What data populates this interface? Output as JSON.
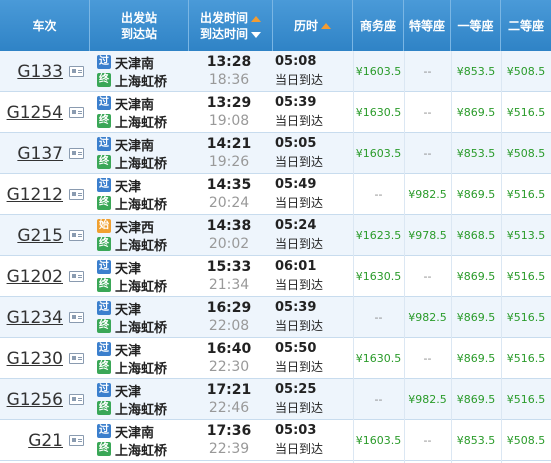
{
  "header": {
    "train": "车次",
    "station_dep": "出发站",
    "station_arr": "到达站",
    "time_dep": "出发时间",
    "time_arr": "到达时间",
    "duration": "历时",
    "business": "商务座",
    "premium": "特等座",
    "first": "一等座",
    "second": "二等座"
  },
  "colors": {
    "header_bg": "#3a8fd0",
    "sort_up": "#f39c32",
    "price": "#2a9b2a",
    "badge_pass": "#3b7fcd",
    "badge_start": "#f0a030",
    "badge_end": "#3aa757"
  },
  "rows": [
    {
      "train": "G133",
      "dep_badge": "过",
      "dep_badge_type": "guo",
      "dep": "天津南",
      "arr_badge": "终",
      "arr": "上海虹桥",
      "dep_time": "13:28",
      "arr_time": "18:36",
      "dur": "05:08",
      "arrive_note": "当日到达",
      "business": "¥1603.5",
      "premium": "--",
      "first": "¥853.5",
      "second": "¥508.5"
    },
    {
      "train": "G1254",
      "dep_badge": "过",
      "dep_badge_type": "guo",
      "dep": "天津南",
      "arr_badge": "终",
      "arr": "上海虹桥",
      "dep_time": "13:29",
      "arr_time": "19:08",
      "dur": "05:39",
      "arrive_note": "当日到达",
      "business": "¥1630.5",
      "premium": "--",
      "first": "¥869.5",
      "second": "¥516.5"
    },
    {
      "train": "G137",
      "dep_badge": "过",
      "dep_badge_type": "guo",
      "dep": "天津南",
      "arr_badge": "终",
      "arr": "上海虹桥",
      "dep_time": "14:21",
      "arr_time": "19:26",
      "dur": "05:05",
      "arrive_note": "当日到达",
      "business": "¥1603.5",
      "premium": "--",
      "first": "¥853.5",
      "second": "¥508.5"
    },
    {
      "train": "G1212",
      "dep_badge": "过",
      "dep_badge_type": "guo",
      "dep": "天津",
      "arr_badge": "终",
      "arr": "上海虹桥",
      "dep_time": "14:35",
      "arr_time": "20:24",
      "dur": "05:49",
      "arrive_note": "当日到达",
      "business": "--",
      "premium": "¥982.5",
      "first": "¥869.5",
      "second": "¥516.5"
    },
    {
      "train": "G215",
      "dep_badge": "始",
      "dep_badge_type": "shi",
      "dep": "天津西",
      "arr_badge": "终",
      "arr": "上海虹桥",
      "dep_time": "14:38",
      "arr_time": "20:02",
      "dur": "05:24",
      "arrive_note": "当日到达",
      "business": "¥1623.5",
      "premium": "¥978.5",
      "first": "¥868.5",
      "second": "¥513.5"
    },
    {
      "train": "G1202",
      "dep_badge": "过",
      "dep_badge_type": "guo",
      "dep": "天津",
      "arr_badge": "终",
      "arr": "上海虹桥",
      "dep_time": "15:33",
      "arr_time": "21:34",
      "dur": "06:01",
      "arrive_note": "当日到达",
      "business": "¥1630.5",
      "premium": "--",
      "first": "¥869.5",
      "second": "¥516.5"
    },
    {
      "train": "G1234",
      "dep_badge": "过",
      "dep_badge_type": "guo",
      "dep": "天津",
      "arr_badge": "终",
      "arr": "上海虹桥",
      "dep_time": "16:29",
      "arr_time": "22:08",
      "dur": "05:39",
      "arrive_note": "当日到达",
      "business": "--",
      "premium": "¥982.5",
      "first": "¥869.5",
      "second": "¥516.5"
    },
    {
      "train": "G1230",
      "dep_badge": "过",
      "dep_badge_type": "guo",
      "dep": "天津",
      "arr_badge": "终",
      "arr": "上海虹桥",
      "dep_time": "16:40",
      "arr_time": "22:30",
      "dur": "05:50",
      "arrive_note": "当日到达",
      "business": "¥1630.5",
      "premium": "--",
      "first": "¥869.5",
      "second": "¥516.5"
    },
    {
      "train": "G1256",
      "dep_badge": "过",
      "dep_badge_type": "guo",
      "dep": "天津",
      "arr_badge": "终",
      "arr": "上海虹桥",
      "dep_time": "17:21",
      "arr_time": "22:46",
      "dur": "05:25",
      "arrive_note": "当日到达",
      "business": "--",
      "premium": "¥982.5",
      "first": "¥869.5",
      "second": "¥516.5"
    },
    {
      "train": "G21",
      "dep_badge": "过",
      "dep_badge_type": "guo",
      "dep": "天津南",
      "arr_badge": "终",
      "arr": "上海虹桥",
      "dep_time": "17:36",
      "arr_time": "22:39",
      "dur": "05:03",
      "arrive_note": "当日到达",
      "business": "¥1603.5",
      "premium": "--",
      "first": "¥853.5",
      "second": "¥508.5"
    }
  ]
}
